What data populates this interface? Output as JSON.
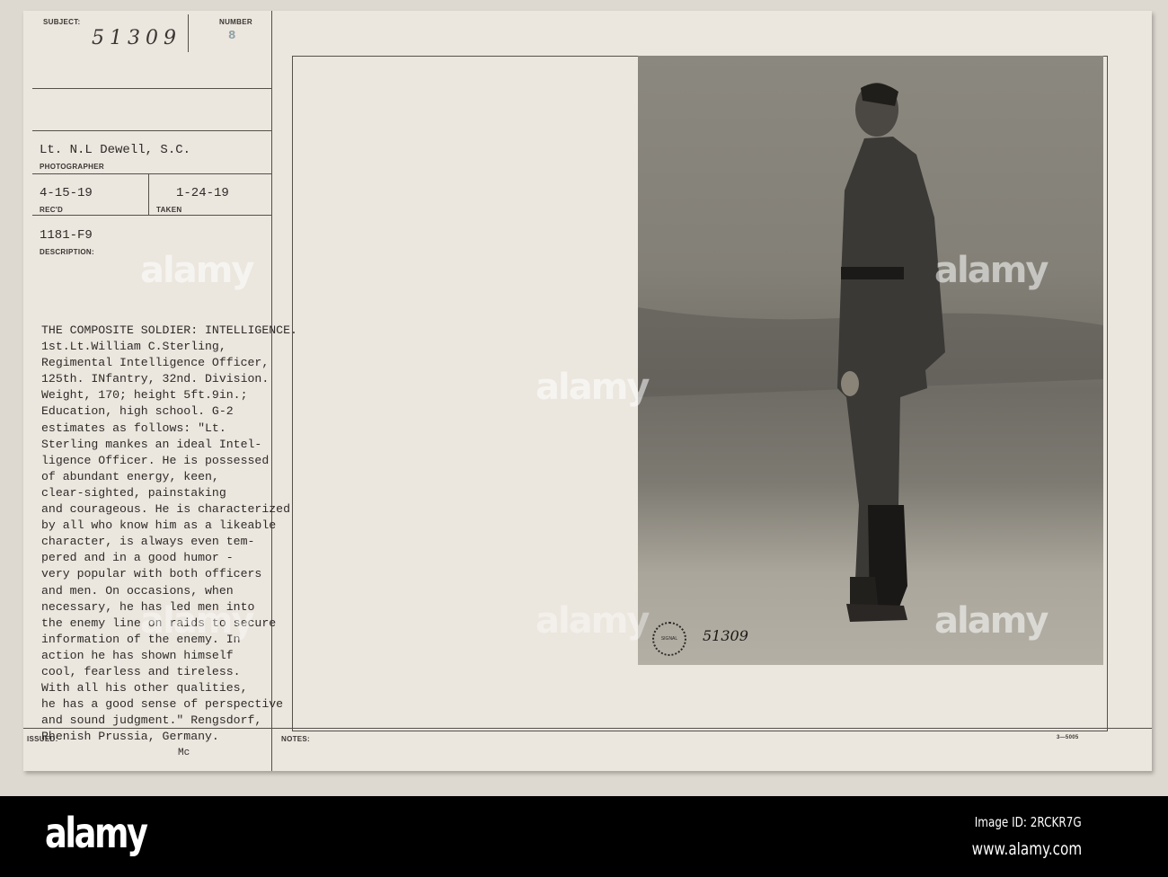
{
  "card": {
    "subject_label": "SUBJECT:",
    "subject_value": "51309",
    "number_label": "NUMBER",
    "number_value": "8",
    "photographer_value": "Lt. N.L Dewell, S.C.",
    "photographer_label": "PHOTOGRAPHER",
    "recd_value": "4-15-19",
    "recd_label": "REC'D",
    "taken_value": "1-24-19",
    "taken_label": "TAKEN",
    "ref_value": "1181-F9",
    "description_label": "DESCRIPTION:",
    "description_lines": [
      "THE COMPOSITE SOLDIER: INTELLIGENCE.",
      "1st.Lt.William C.Sterling,",
      "Regimental Intelligence Officer,",
      "125th. INfantry, 32nd. Division.",
      "Weight, 170; height 5ft.9in.;",
      "Education, high school. G-2",
      "estimates as follows: \"Lt.",
      "Sterling mankes an ideal Intel-",
      "ligence Officer. He is possessed",
      "of abundant energy, keen,",
      "clear-sighted, painstaking",
      "and courageous. He is characterized",
      "by all who know him as a likeable",
      "character, is always even tem-",
      "pered and in a good humor -",
      "very popular with both officers",
      "and men. On occasions, when",
      "necessary, he has led men into",
      "the enemy line on raids to secure",
      "information of the enemy. In",
      "action he has shown himself",
      "cool, fearless and tireless.",
      "With all his other qualities,",
      "he has a good sense of perspective",
      "and sound judgment.\" Rengsdorf,",
      "Rhenish Prussia, Germany."
    ],
    "issued_label": "ISSUED:",
    "issued_value": "Mc",
    "notes_label": "NOTES:",
    "form_code": "3—5005"
  },
  "photo": {
    "stamp_text": "SIGNAL CORPS U.S.A.",
    "photo_number": "51309"
  },
  "watermark": {
    "text": "alamy",
    "image_id": "Image ID: 2RCKR7G",
    "site": "www.alamy.com"
  }
}
